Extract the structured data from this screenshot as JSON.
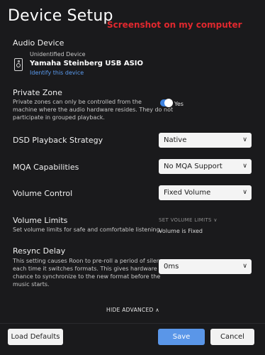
{
  "title": "Device Setup",
  "annotation": "Screenshot on my computer",
  "audio_device": {
    "section_label": "Audio Device",
    "subtitle": "Unidentified Device",
    "name": "Yamaha Steinberg USB ASIO",
    "link": "Identify this device",
    "icon": "speaker-icon"
  },
  "private_zone": {
    "label": "Private Zone",
    "desc_line1": "Private zones can only be controlled from the",
    "desc_line2": "machine where the audio hardware resides. They do not",
    "desc_line3": "participate in grouped playback.",
    "toggle_label": "Yes",
    "toggle_on": true
  },
  "dsd": {
    "label": "DSD Playback Strategy",
    "value": "Native"
  },
  "mqa": {
    "label": "MQA Capabilities",
    "value": "No MQA Support"
  },
  "volume_control": {
    "label": "Volume Control",
    "value": "Fixed Volume"
  },
  "volume_limits": {
    "label": "Volume Limits",
    "desc": "Set volume limits for safe and comfortable listening.",
    "action": "SET VOLUME LIMITS",
    "note": "Volume is Fixed"
  },
  "resync": {
    "label": "Resync Delay",
    "desc_line1": "This setting causes Roon to pre-roll a period of silence",
    "desc_line2": "each time it switches formats. This gives hardware a",
    "desc_line3": "chance to synchronize to the new format before the",
    "desc_line4": "music starts.",
    "value": "0ms"
  },
  "hide_advanced": "HIDE ADVANCED",
  "buttons": {
    "load_defaults": "Load Defaults",
    "save": "Save",
    "cancel": "Cancel"
  },
  "colors": {
    "background": "#1a1a1c",
    "accent": "#5a96e8",
    "annotation": "#e0282e"
  }
}
